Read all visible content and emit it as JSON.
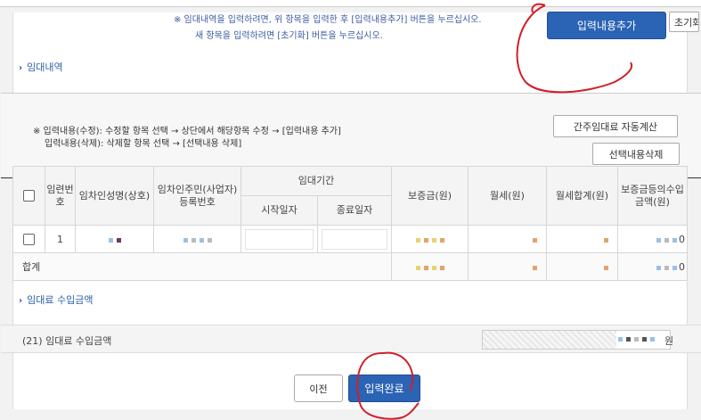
{
  "notice": {
    "line1": "※ 임대내역을 입력하려면, 위 항목을 입력한 후 [입력내용추가] 버튼을 누르십시오.",
    "line2": "새 항목을 입력하려면 [초기화] 버튼을 누르십시오."
  },
  "buttons": {
    "add_entry": "입력내용추가",
    "reset": "초기화",
    "auto_calc": "간주임대료 자동계산",
    "delete_selected": "선택내용삭제",
    "prev": "이전",
    "complete": "입력완료"
  },
  "sections": {
    "rental_details": "임대내역",
    "rental_income": "임대료 수입금액"
  },
  "instructions": {
    "edit": "※ 입력내용(수정): 수정할 항목 선택 → 상단에서 해당항목 수정 → [입력내용 추가]",
    "delete": "입력내용(삭제): 삭제할 항목 선택 → [선택내용 삭제]"
  },
  "table": {
    "headers": {
      "no": "임련번호",
      "tenant_name": "임차인성명(상호)",
      "tenant_id": "임차인주민(사업자)등록번호",
      "period": "임대기간",
      "start_date": "시작일자",
      "end_date": "종료일자",
      "deposit": "보증금(원)",
      "monthly_rent": "월세(원)",
      "monthly_total": "월세합계(원)",
      "deposit_income": "보증금등의수입금액(원)"
    },
    "rows": [
      {
        "no": "1",
        "income_tail": "0"
      }
    ],
    "total": {
      "label": "합계",
      "income_tail": "0"
    }
  },
  "income": {
    "label": "(21) 임대료 수입금액",
    "unit": "원"
  },
  "colors": {
    "primary_button": "#2b63b5",
    "link": "#2b5faa",
    "notice_text": "#3a5aa0",
    "annotation": "#d11f2a"
  }
}
